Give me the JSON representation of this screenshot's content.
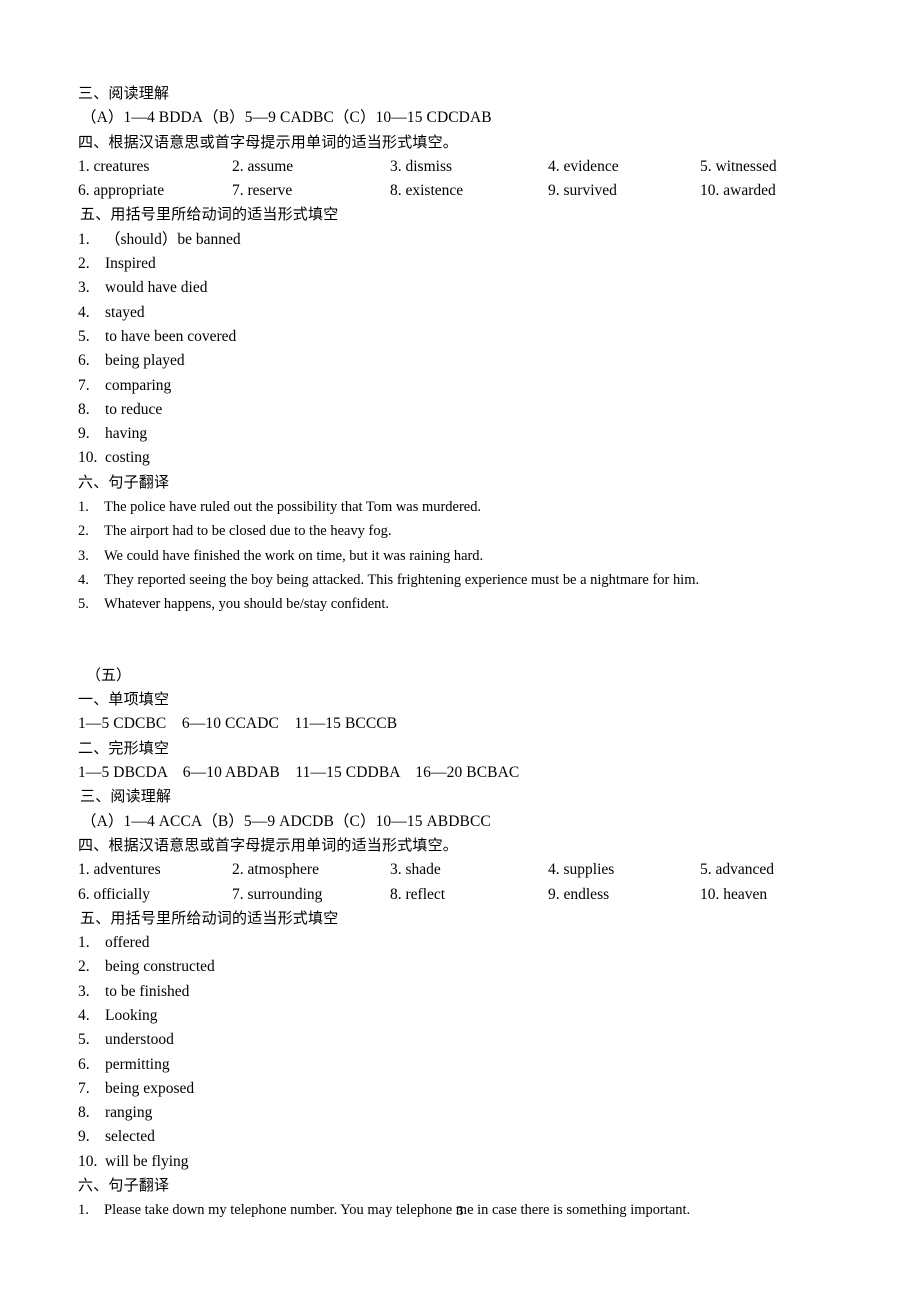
{
  "document": {
    "page_number": "3"
  },
  "section_four_tail": {
    "reading_heading": "三、阅读理解",
    "reading_answers": "（A）1—4 BDDA（B）5—9 CADBC（C）10—15 CDCDAB",
    "vocab_heading": "四、根据汉语意思或首字母提示用单词的适当形式填空。",
    "vocab_rows": [
      [
        "1. creatures",
        "2. assume",
        "3. dismiss",
        "4. evidence",
        "5. witnessed"
      ],
      [
        "6. appropriate",
        "7. reserve",
        "8. existence",
        "9. survived",
        "10. awarded"
      ]
    ],
    "verbform_heading": "五、用括号里所给动词的适当形式填空",
    "verbform_answers": [
      {
        "num": "1.",
        "text": "（should）be banned"
      },
      {
        "num": "2.",
        "text": "Inspired"
      },
      {
        "num": "3.",
        "text": "would have died"
      },
      {
        "num": "4.",
        "text": "stayed"
      },
      {
        "num": "5.",
        "text": "to have been covered"
      },
      {
        "num": "6.",
        "text": "being played"
      },
      {
        "num": "7.",
        "text": "comparing"
      },
      {
        "num": "8.",
        "text": "to reduce"
      },
      {
        "num": "9.",
        "text": "having"
      },
      {
        "num": "10.",
        "text": "costing"
      }
    ],
    "translation_heading": "六、句子翻译",
    "translation_answers": [
      {
        "num": "1.",
        "text": "The police have ruled out the possibility that Tom was murdered."
      },
      {
        "num": "2.",
        "text": "The airport had to be closed due to the heavy fog."
      },
      {
        "num": "3.",
        "text": "We could have finished the work on time, but it was raining hard."
      },
      {
        "num": "4.",
        "text": "They reported seeing the boy being attacked. This frightening experience must be a nightmare for him."
      },
      {
        "num": "5.",
        "text": "Whatever happens, you should be/stay confident."
      }
    ]
  },
  "section_five": {
    "label": "（五）",
    "single_choice_heading": "一、单项填空",
    "single_choice_answers": "1—5 CDCBC　6—10 CCADC　11—15 BCCCB",
    "cloze_heading": "二、完形填空",
    "cloze_answers": "1—5 DBCDA　6—10 ABDAB　11—15 CDDBA　16—20 BCBAC",
    "reading_heading": "三、阅读理解",
    "reading_answers": "（A）1—4 ACCA（B）5—9 ADCDB（C）10—15 ABDBCC",
    "vocab_heading": "四、根据汉语意思或首字母提示用单词的适当形式填空。",
    "vocab_rows": [
      [
        "1. adventures",
        "2. atmosphere",
        "3. shade",
        "4. supplies",
        "5. advanced"
      ],
      [
        "6. officially",
        "7. surrounding",
        "8. reflect",
        "9. endless",
        "10. heaven"
      ]
    ],
    "verbform_heading": "五、用括号里所给动词的适当形式填空",
    "verbform_answers": [
      {
        "num": "1.",
        "text": "offered"
      },
      {
        "num": "2.",
        "text": "being constructed"
      },
      {
        "num": "3.",
        "text": "to be finished"
      },
      {
        "num": "4.",
        "text": "Looking"
      },
      {
        "num": "5.",
        "text": "understood"
      },
      {
        "num": "6.",
        "text": "permitting"
      },
      {
        "num": "7.",
        "text": "being exposed"
      },
      {
        "num": "8.",
        "text": "ranging"
      },
      {
        "num": "9.",
        "text": "selected"
      },
      {
        "num": "10.",
        "text": "will be flying"
      }
    ],
    "translation_heading": "六、句子翻译",
    "translation_answers": [
      {
        "num": "1.",
        "text": "Please take down my telephone number. You may telephone me in case there is something important."
      }
    ]
  }
}
